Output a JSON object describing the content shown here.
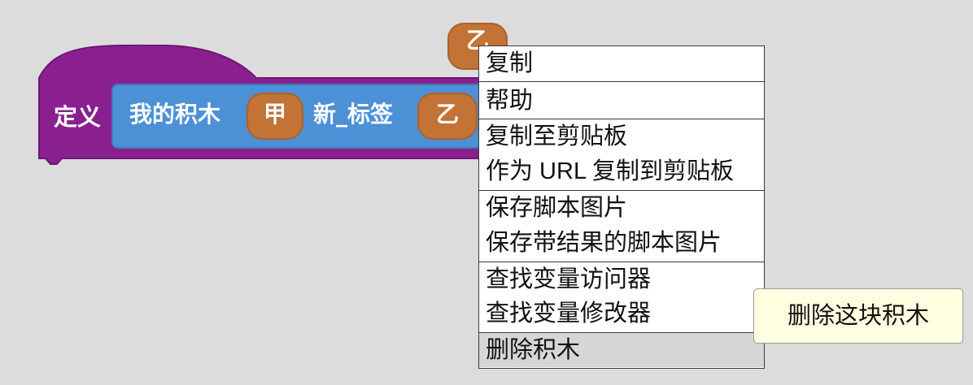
{
  "define_block": {
    "label": "定义",
    "color": "#8a1f8f",
    "prototype": {
      "color": "#4c90d6",
      "text1": "我的积木",
      "arg1": "甲",
      "text2": "新_标签",
      "arg2": "乙"
    }
  },
  "floating_argument": "乙",
  "context_menu": {
    "items": [
      {
        "label": "复制"
      },
      {
        "label": "帮助"
      },
      {
        "label": "复制至剪贴板"
      },
      {
        "label": "作为 URL 复制到剪贴板"
      },
      {
        "label": "保存脚本图片"
      },
      {
        "label": "保存带结果的脚本图片"
      },
      {
        "label": "查找变量访问器"
      },
      {
        "label": "查找变量修改器"
      },
      {
        "label": "删除积木",
        "hovered": true
      }
    ]
  },
  "tooltip": "删除这块积木",
  "colors": {
    "background": "#dcdcdc",
    "argument": "#c27335",
    "menu_hover": "#d6d6d6",
    "tooltip_bg": "#ffffe1"
  }
}
